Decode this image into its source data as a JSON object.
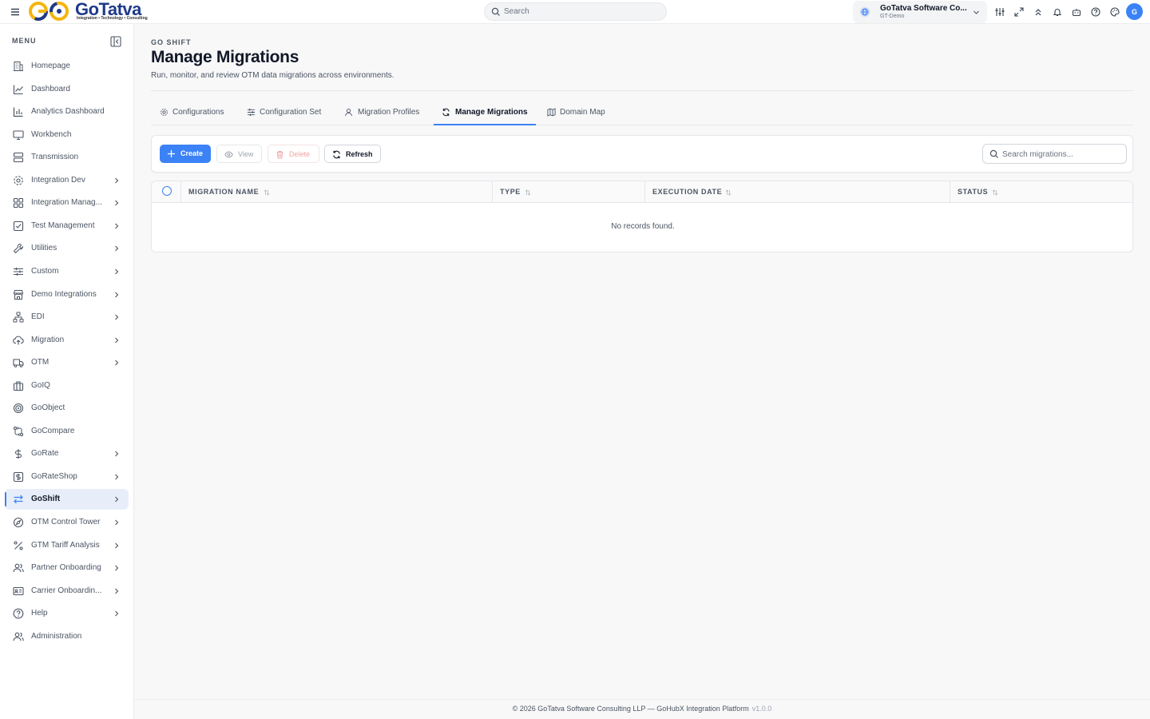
{
  "app": {
    "logo_text": "GoTatva",
    "logo_tagline": "Integration • Technology • Consulting",
    "search_placeholder": "Search",
    "org_name": "GoTatva Software Co...",
    "org_env": "GT-Demo",
    "avatar_initial": "G",
    "accent": "#3b82f6"
  },
  "sidebar": {
    "title": "MENU",
    "items": [
      {
        "label": "Homepage",
        "icon": "building-icon",
        "chevron": false
      },
      {
        "label": "Dashboard",
        "icon": "chart-line-icon",
        "chevron": false
      },
      {
        "label": "Analytics Dashboard",
        "icon": "bar-chart-icon",
        "chevron": false
      },
      {
        "label": "Workbench",
        "icon": "monitor-icon",
        "chevron": false
      },
      {
        "label": "Transmission",
        "icon": "server-icon",
        "chevron": false
      },
      {
        "label": "Integration Dev",
        "icon": "gear-icon",
        "chevron": true
      },
      {
        "label": "Integration Manag...",
        "icon": "grid-icon",
        "chevron": true
      },
      {
        "label": "Test Management",
        "icon": "checkbox-icon",
        "chevron": true
      },
      {
        "label": "Utilities",
        "icon": "wrench-icon",
        "chevron": true
      },
      {
        "label": "Custom",
        "icon": "sliders-icon",
        "chevron": true
      },
      {
        "label": "Demo Integrations",
        "icon": "store-icon",
        "chevron": true
      },
      {
        "label": "EDI",
        "icon": "network-icon",
        "chevron": true
      },
      {
        "label": "Migration",
        "icon": "cloud-upload-icon",
        "chevron": true
      },
      {
        "label": "OTM",
        "icon": "truck-icon",
        "chevron": true
      },
      {
        "label": "GoIQ",
        "icon": "briefcase-icon",
        "chevron": false
      },
      {
        "label": "GoObject",
        "icon": "target-icon",
        "chevron": false
      },
      {
        "label": "GoCompare",
        "icon": "git-compare-icon",
        "chevron": false
      },
      {
        "label": "GoRate",
        "icon": "dollar-icon",
        "chevron": true
      },
      {
        "label": "GoRateShop",
        "icon": "dollar-square-icon",
        "chevron": true
      },
      {
        "label": "GoShift",
        "icon": "arrows-swap-icon",
        "chevron": true,
        "active": true
      },
      {
        "label": "OTM Control Tower",
        "icon": "compass-icon",
        "chevron": true
      },
      {
        "label": "GTM Tariff Analysis",
        "icon": "percent-icon",
        "chevron": true
      },
      {
        "label": "Partner Onboarding",
        "icon": "users-icon",
        "chevron": true
      },
      {
        "label": "Carrier Onboardin...",
        "icon": "id-card-icon",
        "chevron": true
      },
      {
        "label": "Help",
        "icon": "help-circle-icon",
        "chevron": true
      },
      {
        "label": "Administration",
        "icon": "users-icon",
        "chevron": false
      }
    ]
  },
  "page": {
    "breadcrumb": "GO SHIFT",
    "title": "Manage Migrations",
    "subtitle": "Run, monitor, and review OTM data migrations across environments."
  },
  "tabs": [
    {
      "label": "Configurations",
      "icon": "gear-icon"
    },
    {
      "label": "Configuration Set",
      "icon": "sliders-icon"
    },
    {
      "label": "Migration Profiles",
      "icon": "user-icon"
    },
    {
      "label": "Manage Migrations",
      "icon": "refresh-icon",
      "active": true
    },
    {
      "label": "Domain Map",
      "icon": "map-icon"
    }
  ],
  "toolbar": {
    "create": "Create",
    "view": "View",
    "delete": "Delete",
    "refresh": "Refresh",
    "search_placeholder": "Search migrations..."
  },
  "table": {
    "columns": [
      "MIGRATION NAME",
      "TYPE",
      "EXECUTION DATE",
      "STATUS"
    ],
    "rows": [],
    "empty_message": "No records found."
  },
  "footer": {
    "text": "© 2026 GoTatva Software Consulting LLP — GoHubX Integration Platform",
    "version": "v1.0.0"
  }
}
